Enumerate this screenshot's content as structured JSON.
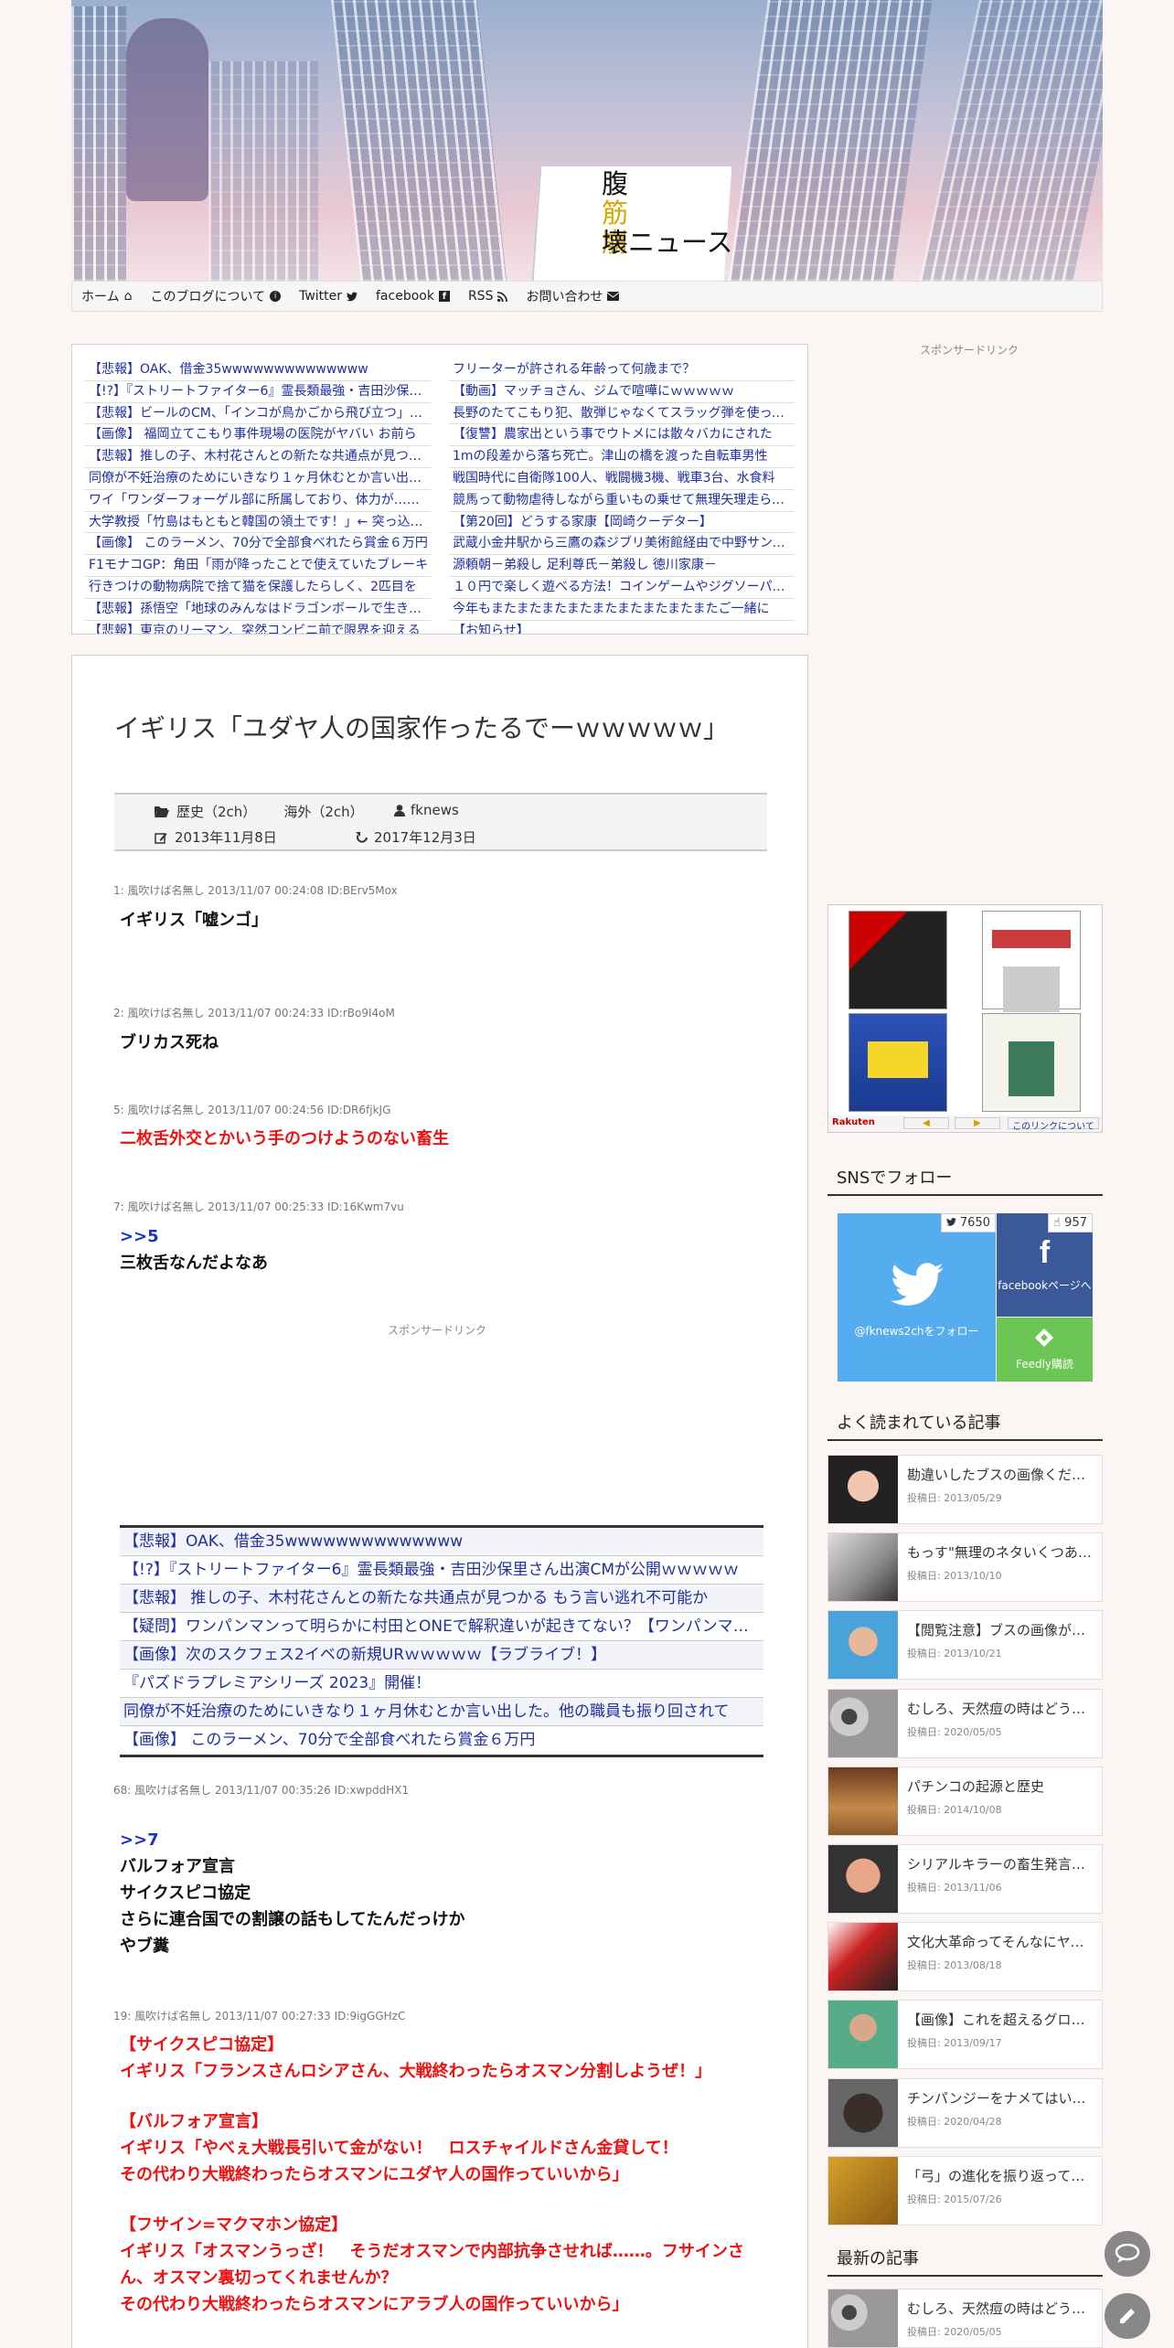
{
  "site": {
    "title_lines": [
      "腹",
      "筋",
      "崩",
      "壊ニュース"
    ]
  },
  "nav": [
    {
      "label": "ホーム",
      "icon": "home-icon"
    },
    {
      "label": "このブログについて",
      "icon": "info-icon"
    },
    {
      "label": "Twitter",
      "icon": "twitter-icon"
    },
    {
      "label": "facebook",
      "icon": "facebook-icon"
    },
    {
      "label": "RSS",
      "icon": "rss-icon"
    },
    {
      "label": "お問い合わせ",
      "icon": "mail-icon"
    }
  ],
  "link_list": {
    "left": [
      "【悲報】OAK、借金35wwwwwwwwwwwwww",
      "【!?】『ストリートファイター6』霊長類最強・吉田沙保里さん出演CMが",
      "【悲報】ビールのCM、「インコが鳥かごから飛び立つ」演出",
      "【画像】 福岡立てこもり事件現場の医院がヤバい お前ら",
      "【悲報】推しの子、木村花さんとの新たな共通点が見つかる",
      "同僚が不妊治療のためにいきなり１ヶ月休むとか言い出した",
      "ワイ「ワンダーフォーゲル部に所属しており、体力が……",
      "大学教授「竹島はもともと韓国の領土です！」← 突っ込みどころ",
      "【画像】 このラーメン、70分で全部食べれたら賞金６万円",
      "F1モナコGP：角田「雨が降ったことで使えていたブレーキ",
      "行きつけの動物病院で捨て猫を保護したらしく、2匹目を",
      "【悲報】孫悟空「地球のみんなはドラゴンボールで生き返る",
      "【悲報】東京のリーマン、突然コンビニ前で限界を迎える"
    ],
    "right": [
      "フリーターが許される年齢って何歳まで？",
      "【動画】マッチョさん、ジムで喧嘩にｗｗｗｗｗ",
      "長野のたてこもり犯、散弾じゃなくてスラッグ弾を使ってた",
      "【復讐】農家出という事でウトメには散々バカにされた",
      "1mの段差から落ち死亡。津山の橋を渡った自転車男性",
      "戦国時代に自衛隊100人、戦闘機3機、戦車3台、水食料",
      "競馬って動物虐待しながら重いもの乗せて無理矢理走らせる",
      "【第20回】どうする家康【岡崎クーデター】",
      "武蔵小金井駅から三鷹の森ジブリ美術館経由で中野サンプラザ",
      "源頼朝－弟殺し 足利尊氏－弟殺し 徳川家康－",
      "１０円で楽しく遊べる方法！コインゲームやジグソーパズル",
      "今年もまたまたまたまたまたまたまたまたまたご一緒に",
      "【お知らせ】"
    ]
  },
  "article": {
    "title": "イギリス「ユダヤ人の国家作ったるでーｗｗｗｗｗ」",
    "categories": [
      "歴史（2ch）",
      "海外（2ch）"
    ],
    "author": "fknews",
    "published": "2013年11月8日",
    "updated": "2017年12月3日",
    "posts": [
      {
        "header": "1: 風吹けば名無し 2013/11/07 00:24:08 ID:BErv5Mox",
        "lines": [
          "イギリス「嘘ンゴ」"
        ]
      },
      {
        "header": "2: 風吹けば名無し 2013/11/07 00:24:33 ID:rBo9I4oM",
        "lines": [
          "ブリカス死ね"
        ]
      },
      {
        "header": "5: 風吹けば名無し 2013/11/07 00:24:56 ID:DR6fjkJG",
        "lines": [
          "二枚舌外交とかいう手のつけようのない畜生"
        ]
      },
      {
        "header": "7: 風吹けば名無し 2013/11/07 00:25:33 ID:16Kwm7vu",
        "anchor": ">>5",
        "lines": [
          "三枚舌なんだよなあ"
        ]
      },
      {
        "header": "68: 風吹けば名無し 2013/11/07 00:35:26 ID:xwpddHX1",
        "anchor": ">>7",
        "lines": [
          "バルフォア宣言",
          "サイクスピコ協定",
          "さらに連合国での割譲の話もしてたんだっけか",
          "やブ糞"
        ]
      },
      {
        "header": "19: 風吹けば名無し 2013/11/07 00:27:33 ID:9igGGHzC",
        "lines": [
          "【サイクスピコ協定】",
          "イギリス「フランスさんロシアさん、大戦終わったらオスマン分割しようぜ！」",
          "",
          "【バルフォア宣言】",
          "イギリス「やべぇ大戦長引いて金がない！　ロスチャイルドさん金貸して！",
          "その代わり大戦終わったらオスマンにユダヤ人の国作っていいから」",
          "",
          "【フサイン=マクマホン協定】",
          "イギリス「オスマンうっざ！　そうだオスマンで内部抗争させれば……。フサインさん、オスマン裏切ってくれませんか？",
          "その代わり大戦終わったらオスマンにアラブ人の国作っていいから」"
        ]
      }
    ],
    "sponsored_label": "スポンサードリンク",
    "related": [
      "【悲報】OAK、借金35wwwwwwwwwwwwww",
      "【!?】『ストリートファイター6』霊長類最強・吉田沙保里さん出演CMが公開ｗｗｗｗｗ",
      "【悲報】 推しの子、木村花さんとの新たな共通点が見つかる もう言い逃れ不可能か",
      "【疑問】ワンパンマンって明らかに村田とONEで解釈違いが起きてない？【ワンパンマン】",
      "【画像】次のスクフェス2イベの新規URｗｗｗｗｗ【ラブライブ！】",
      "『パズドラプレミアシリーズ 2023』開催！",
      "同僚が不妊治療のためにいきなり１ヶ月休むとか言い出した。他の職員も振り回されて",
      "【画像】 このラーメン、70分で全部食べれたら賞金６万円"
    ]
  },
  "sidebar": {
    "sponsored_label": "スポンサードリンク",
    "rakuten": {
      "logo": "Rakuten",
      "prev": "◀",
      "next": "▶",
      "about": "このリンクについて"
    },
    "sns": {
      "title": "SNSでフォロー",
      "twitter_count": "7650",
      "twitter_label": "@fknews2chをフォロー",
      "facebook_count": "957",
      "facebook_label": "facebookページへ",
      "feedly_label": "Feedly購読"
    },
    "popular_title": "よく読まれている記事",
    "popular": [
      {
        "title": "勘違いしたブスの画像ください",
        "date": "投稿日: 2013/05/29"
      },
      {
        "title": "もっす\"無理のネタいくつある？",
        "date": "投稿日: 2013/10/10"
      },
      {
        "title": "【閲覧注意】ブスの画像が集まる",
        "date": "投稿日: 2013/10/21"
      },
      {
        "title": "むしろ、天然痘の時はどうだった",
        "date": "投稿日: 2020/05/05"
      },
      {
        "title": "パチンコの起源と歴史",
        "date": "投稿日: 2014/10/08"
      },
      {
        "title": "シリアルキラーの畜生発言で打線",
        "date": "投稿日: 2013/11/06"
      },
      {
        "title": "文化大革命ってそんなにヤバかった",
        "date": "投稿日: 2013/08/18"
      },
      {
        "title": "【画像】これを超えるグロメン",
        "date": "投稿日: 2013/09/17"
      },
      {
        "title": "チンパンジーをナメてはいけない",
        "date": "投稿日: 2020/04/28"
      },
      {
        "title": "「弓」の進化を振り返ってみよう",
        "date": "投稿日: 2015/07/26"
      }
    ],
    "latest_title": "最新の記事",
    "latest": [
      {
        "title": "むしろ、天然痘の時はどうだった",
        "date": "投稿日: 2020/05/05"
      }
    ]
  }
}
